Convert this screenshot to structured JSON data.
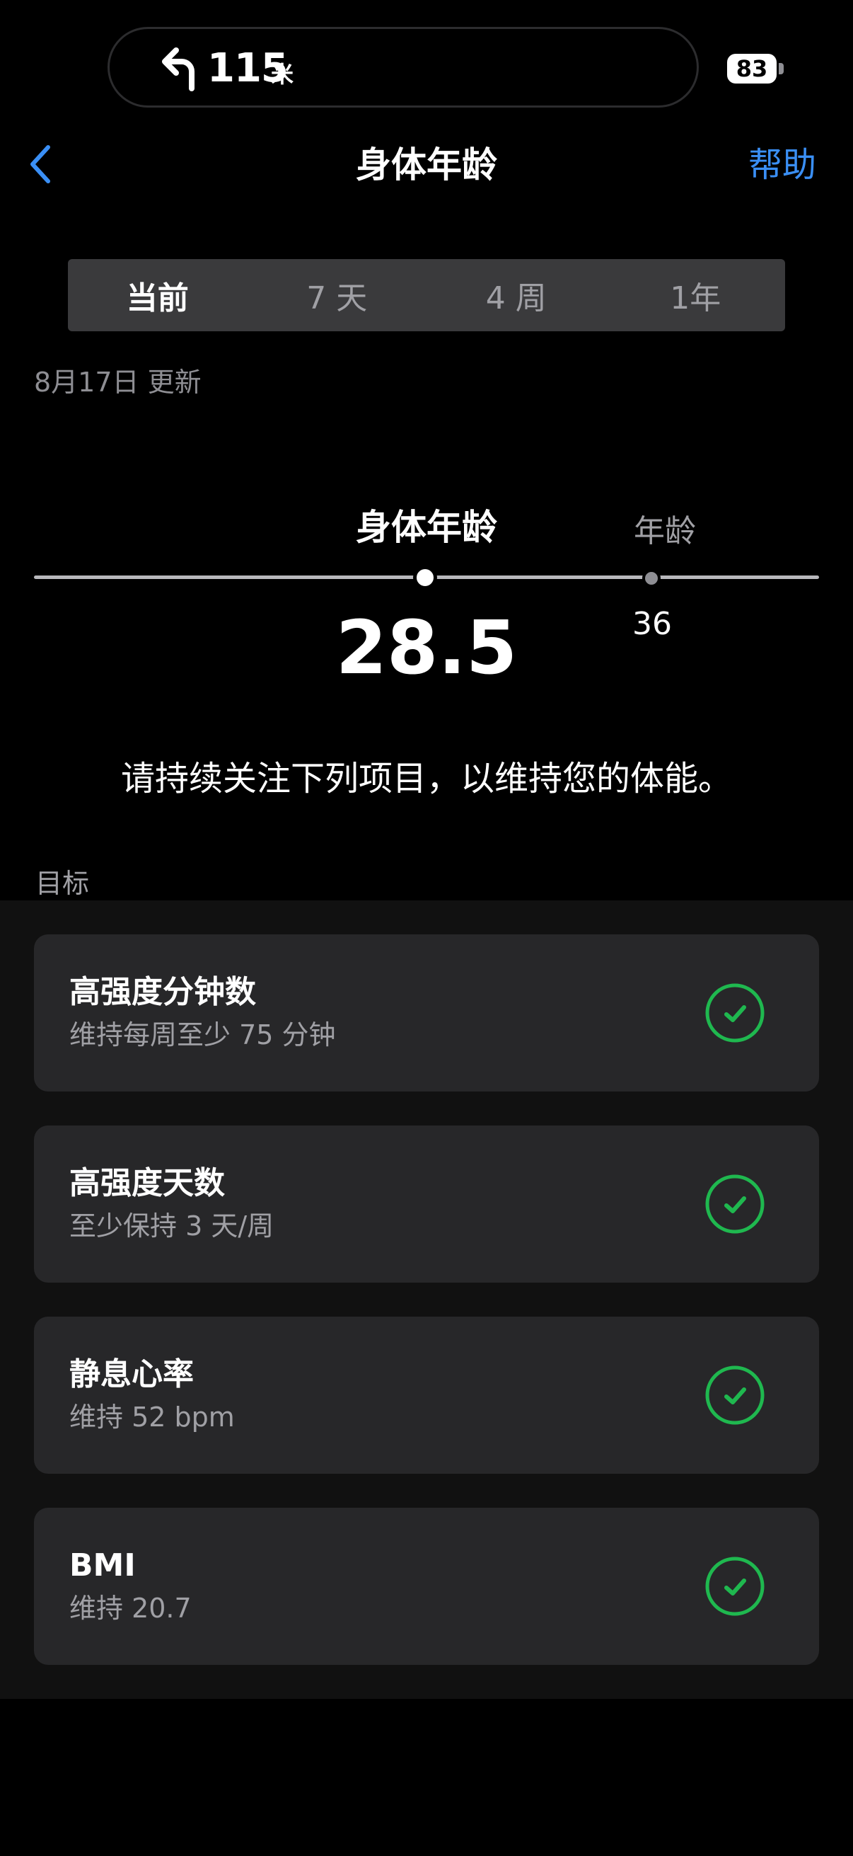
{
  "status_bar": {
    "navigation": {
      "icon": "turn-left-arrow-icon",
      "distance": "115",
      "unit": "米"
    },
    "battery": "83"
  },
  "nav": {
    "back_icon": "chevron-left-icon",
    "title": "身体年龄",
    "help": "帮助"
  },
  "tabs": [
    {
      "label": "当前",
      "active": true
    },
    {
      "label": "7 天",
      "active": false
    },
    {
      "label": "4 周",
      "active": false
    },
    {
      "label": "1年",
      "active": false
    }
  ],
  "updated": "8月17日 更新",
  "fitness_age": {
    "label": "身体年龄",
    "value": "28.5",
    "age_label": "年龄",
    "age_value": "36"
  },
  "message": "请持续关注下列项目，以维持您的体能。",
  "goals": {
    "section_label": "目标",
    "items": [
      {
        "title": "高强度分钟数",
        "subtitle": "维持每周至少 75 分钟",
        "icon": "check-circle-icon"
      },
      {
        "title": "高强度天数",
        "subtitle": "至少保持 3 天/周",
        "icon": "check-circle-icon"
      },
      {
        "title": "静息心率",
        "subtitle": "维持 52  bpm",
        "icon": "check-circle-icon"
      },
      {
        "title": "BMI",
        "subtitle": "维持 20.7",
        "icon": "check-circle-icon"
      }
    ]
  },
  "colors": {
    "background": "#000000",
    "accent": "#3a8ff5",
    "check": "#1fb84f",
    "card": "#272729"
  }
}
